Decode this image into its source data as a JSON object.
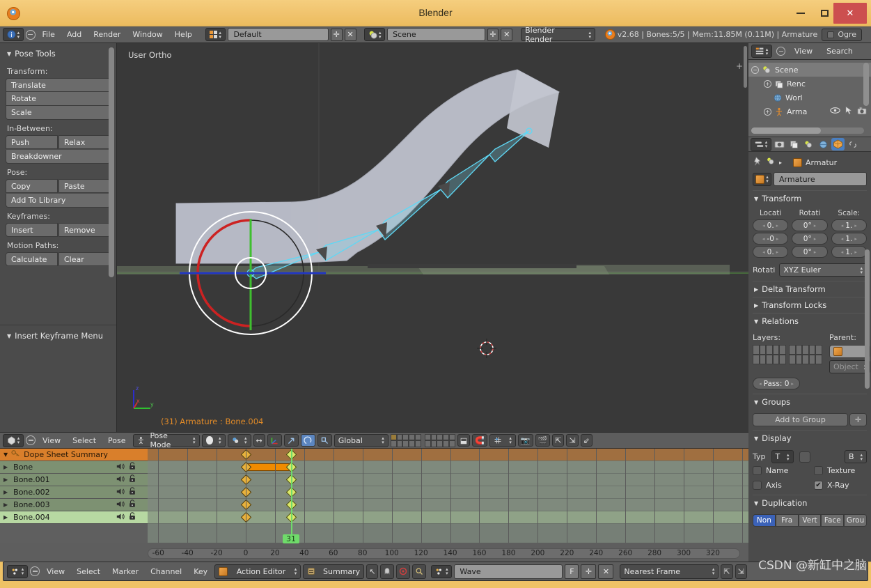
{
  "window": {
    "title": "Blender",
    "minimize_label": "minimize",
    "maximize_label": "maximize",
    "close_label": "✕"
  },
  "header": {
    "menus": [
      "File",
      "Add",
      "Render",
      "Window",
      "Help"
    ],
    "screen_layout": "Default",
    "scene_name": "Scene",
    "render_engine": "Blender Render",
    "version_info": "v2.68 | Bones:5/5  | Mem:11.85M (0.11M) | Armature",
    "ogre_label": "Ogre",
    "add_label": "✛",
    "remove_label": "✕"
  },
  "tool_panel": {
    "title": "Pose Tools",
    "sections": [
      {
        "label": "Transform:",
        "buttons": [
          "Translate",
          "Rotate",
          "Scale"
        ]
      },
      {
        "label": "In-Between:",
        "buttons": [
          "Push",
          "Relax",
          "Breakdowner"
        ]
      },
      {
        "label": "Pose:",
        "buttons": [
          "Copy",
          "Paste",
          "Add To Library"
        ]
      },
      {
        "label": "Keyframes:",
        "buttons": [
          "Insert",
          "Remove"
        ]
      },
      {
        "label": "Motion Paths:",
        "buttons": [
          "Calculate",
          "Clear"
        ]
      }
    ],
    "second_panel_title": "Insert Keyframe Menu"
  },
  "viewport": {
    "view_label": "User Ortho",
    "status_text": "(31) Armature : Bone.004",
    "axis_x": "x",
    "axis_y": "y",
    "axis_z": "z"
  },
  "dope_header": {
    "menus": [
      "View",
      "Select",
      "Pose"
    ],
    "mode": "Pose Mode",
    "orientation": "Global"
  },
  "dope_sheet": {
    "summary_row": "Dope Sheet Summary",
    "channels": [
      "Bone",
      "Bone.001",
      "Bone.002",
      "Bone.003",
      "Bone.004"
    ],
    "selected_channel": "Bone.004",
    "keyframe_frames": [
      0,
      31
    ],
    "current_frame": 31,
    "current_frame_label": "31",
    "ruler_ticks": [
      "-60",
      "-40",
      "-20",
      "0",
      "20",
      "40",
      "60",
      "80",
      "100",
      "120",
      "140",
      "160",
      "180",
      "200",
      "220",
      "240",
      "260",
      "280",
      "300",
      "320"
    ]
  },
  "action_bar": {
    "menus": [
      "View",
      "Select",
      "Marker",
      "Channel",
      "Key"
    ],
    "editor_mode": "Action Editor",
    "mode_filter": "Summary",
    "action_name": "Wave",
    "fake_user_label": "F",
    "add_label": "✛",
    "unlink_label": "✕",
    "snap_mode": "Nearest Frame"
  },
  "outliner": {
    "menus": [
      "View",
      "Search"
    ],
    "items": [
      {
        "label": "Scene",
        "depth": 0,
        "selected": true
      },
      {
        "label": "Renc",
        "depth": 1,
        "selected": false
      },
      {
        "label": "Worl",
        "depth": 1,
        "selected": false
      },
      {
        "label": "Arma",
        "depth": 1,
        "selected": false
      }
    ]
  },
  "properties": {
    "breadcrumb_object": "Armatur",
    "object_name_field": "Armature",
    "panels": {
      "transform": {
        "title": "Transform",
        "columns": [
          "Locati",
          "Rotati",
          "Scale:"
        ],
        "location_values": [
          "0.",
          "-0",
          "0."
        ],
        "rotation_values": [
          "0°",
          "0°",
          "0°"
        ],
        "scale_values": [
          "1.",
          "1.",
          "1."
        ],
        "rotation_mode_label": "Rotati",
        "rotation_mode": "XYZ Euler"
      },
      "delta_transform": {
        "title": "Delta Transform"
      },
      "transform_locks": {
        "title": "Transform Locks"
      },
      "relations": {
        "title": "Relations",
        "layers_label": "Layers:",
        "parent_label": "Parent:",
        "parent_value": "",
        "parent_type": "Object",
        "pass_index": "Pass: 0"
      },
      "groups": {
        "title": "Groups",
        "add_to_group": "Add to Group",
        "add_icon": "✛"
      },
      "display": {
        "title": "Display",
        "type_label": "Typ",
        "type_value": "T",
        "bounds_value": "B",
        "name_label": "Name",
        "texture_label": "Texture",
        "axis_label": "Axis",
        "xray_label": "X-Ray",
        "xray_checked": true
      },
      "duplication": {
        "title": "Duplication",
        "options": [
          "Non",
          "Fra",
          "Vert",
          "Face",
          "Grou"
        ],
        "selected": "Non"
      }
    }
  },
  "watermark": "CSDN @新缸中之脑",
  "colors": {
    "accent_orange": "#e87d1e",
    "titlebar": "#f0c36d",
    "summary_row": "#d97f2b",
    "channel_green": "#7d9172",
    "playhead_green": "#6fdb6a",
    "keyframe": "#e9b23c"
  }
}
